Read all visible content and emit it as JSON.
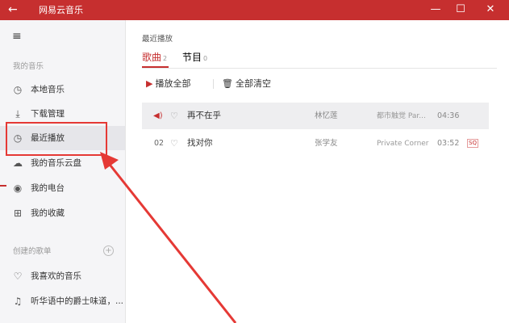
{
  "titlebar": {
    "title": "网易云音乐",
    "back_icon": "←",
    "minimize_icon": "—",
    "maximize_icon": "☐",
    "close_icon": "✕"
  },
  "sidebar": {
    "menu_icon": "≡",
    "section_my": "我的音乐",
    "items": [
      {
        "label": "本地音乐",
        "icon": "◷"
      },
      {
        "label": "下载管理",
        "icon": "⤓"
      },
      {
        "label": "最近播放",
        "icon": "◷"
      },
      {
        "label": "我的音乐云盘",
        "icon": "☁"
      },
      {
        "label": "我的电台",
        "icon": "◉"
      },
      {
        "label": "我的收藏",
        "icon": "⊞"
      }
    ],
    "section_created": "创建的歌单",
    "add_icon": "+",
    "playlists": [
      {
        "label": "我喜欢的音乐",
        "icon": "♡"
      },
      {
        "label": "听华语中的爵士味道，...",
        "icon": "♫"
      }
    ]
  },
  "main": {
    "breadcrumb": "最近播放",
    "tabs": [
      {
        "label": "歌曲",
        "count": "2"
      },
      {
        "label": "节目",
        "count": "0"
      }
    ],
    "actions": {
      "play_all": "播放全部",
      "play_icon": "▶",
      "clear_all": "全部清空",
      "trash_icon": "🗑"
    },
    "songs": [
      {
        "num": "",
        "playing_icon": "◀)",
        "heart": "♡",
        "title": "再不在乎",
        "artist": "林忆莲",
        "album": "都市触觉 Par...",
        "time": "04:36",
        "badge": ""
      },
      {
        "num": "02",
        "playing_icon": "",
        "heart": "♡",
        "title": "找对你",
        "artist": "张学友",
        "album": "Private Corner",
        "time": "03:52",
        "badge": "SQ"
      }
    ]
  },
  "colors": {
    "accent": "#c62f2f",
    "annotation": "#e53935"
  }
}
